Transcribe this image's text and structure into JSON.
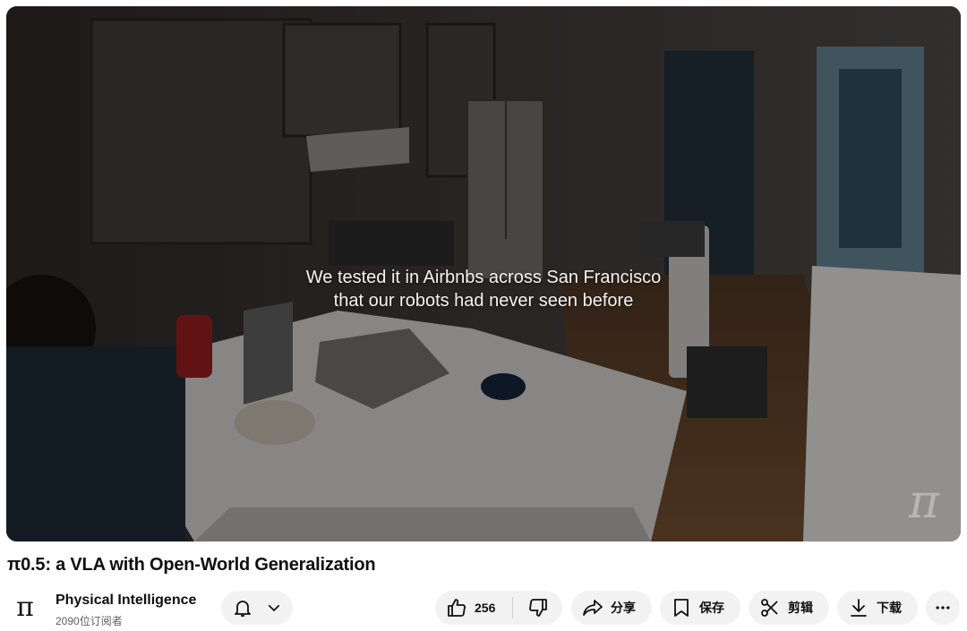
{
  "video": {
    "caption_line1": "We tested it in Airbnbs across San Francisco",
    "caption_line2": "that our robots had never seen before",
    "watermark": "π"
  },
  "title": "π0.5: a VLA with Open-World Generalization",
  "channel": {
    "avatar_glyph": "π",
    "name": "Physical Intelligence",
    "subscribers": "2090位订阅者"
  },
  "actions": {
    "like_count": "256",
    "share_label": "分享",
    "save_label": "保存",
    "clip_label": "剪辑",
    "download_label": "下载"
  },
  "icons": [
    "bell-icon",
    "chevron-down-icon",
    "thumbs-up-icon",
    "thumbs-down-icon",
    "share-icon",
    "bookmark-icon",
    "scissors-icon",
    "download-icon",
    "more-icon"
  ]
}
